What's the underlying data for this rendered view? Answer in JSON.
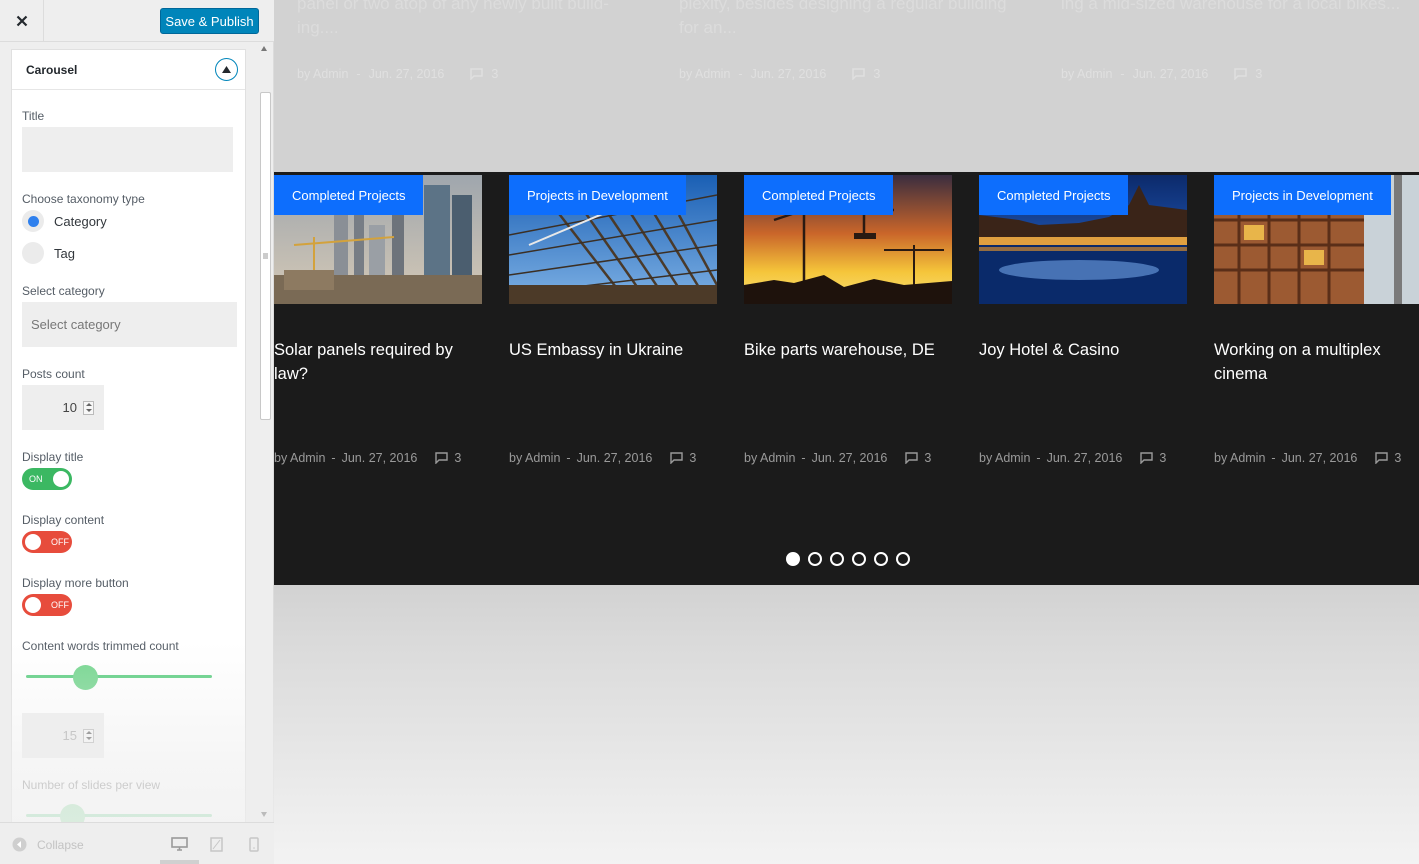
{
  "topbar": {
    "save_label": "Save & Publish"
  },
  "panel": {
    "section_title": "Carousel",
    "title_label": "Title",
    "title_value": "",
    "taxonomy_label": "Choose taxonomy type",
    "taxonomy_options": [
      "Category",
      "Tag"
    ],
    "taxonomy_selected": "Category",
    "select_category_label": "Select category",
    "select_category_placeholder": "Select category",
    "posts_count_label": "Posts count",
    "posts_count_value": "10",
    "display_title_label": "Display title",
    "display_title_state": "ON",
    "display_content_label": "Display content",
    "display_content_state": "OFF",
    "display_more_label": "Display more button",
    "display_more_state": "OFF",
    "trim_label": "Content words trimmed count",
    "trim_value": "15",
    "trim_slider_fraction": 0.29,
    "slides_label": "Number of slides per view",
    "slides_slider_fraction": 0.21
  },
  "footer": {
    "collapse_label": "Collapse"
  },
  "colors": {
    "accent": "#0085ba",
    "badge": "#0d6efd",
    "toggle_on": "#3bb862",
    "toggle_off": "#e74c3c",
    "carousel_bg": "#1b1b1b"
  },
  "faded_posts": [
    {
      "excerpt": "panel or two atop of any newly built build-ing....",
      "author": "by Admin",
      "sep": "-",
      "date": "Jun. 27, 2016",
      "comments": "3"
    },
    {
      "excerpt": "plexity, besides designing a regular building for an...",
      "author": "by Admin",
      "sep": "-",
      "date": "Jun. 27, 2016",
      "comments": "3"
    },
    {
      "excerpt": "ing a mid-sized warehouse for a local bikes...",
      "author": "by Admin",
      "sep": "-",
      "date": "Jun. 27, 2016",
      "comments": "3"
    }
  ],
  "carousel": {
    "cards": [
      {
        "category": "Completed Projects",
        "title": "Solar panels required by law?",
        "author": "by Admin",
        "sep": "-",
        "date": "Jun. 27, 2016",
        "comments": "3"
      },
      {
        "category": "Projects in Development",
        "title": "US Embassy in Ukraine",
        "author": "by Admin",
        "sep": "-",
        "date": "Jun. 27, 2016",
        "comments": "3"
      },
      {
        "category": "Completed Projects",
        "title": "Bike parts warehouse, DE",
        "author": "by Admin",
        "sep": "-",
        "date": "Jun. 27, 2016",
        "comments": "3"
      },
      {
        "category": "Completed Projects",
        "title": "Joy Hotel & Casino",
        "author": "by Admin",
        "sep": "-",
        "date": "Jun. 27, 2016",
        "comments": "3"
      },
      {
        "category": "Projects in Development",
        "title": "Working on a multiplex cinema",
        "author": "by Admin",
        "sep": "-",
        "date": "Jun. 27, 2016",
        "comments": "3"
      }
    ],
    "dots_count": 6,
    "active_dot": 0
  }
}
